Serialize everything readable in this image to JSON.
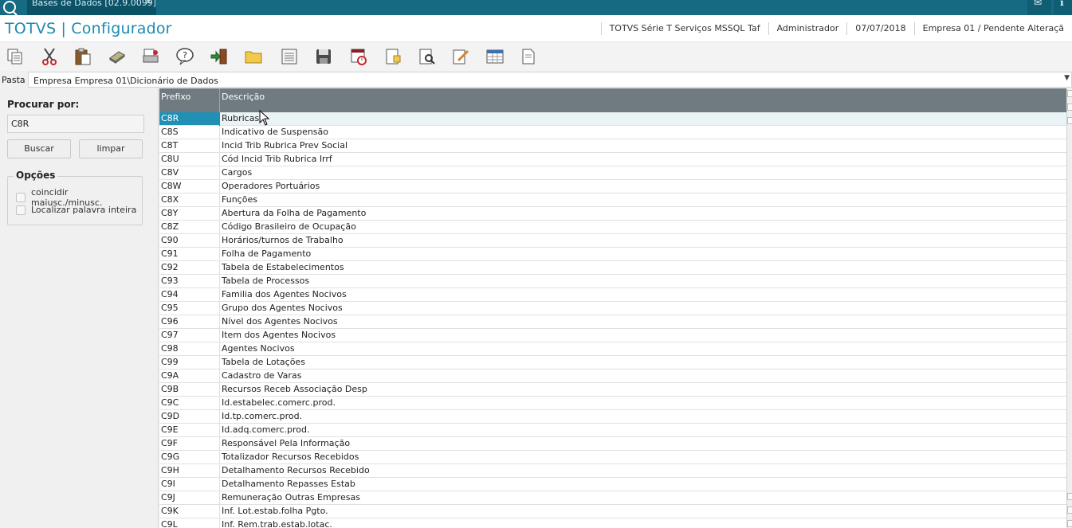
{
  "titlebar": {
    "tab_label": "Bases de Dados [02.9.0099]",
    "tab_close": "×"
  },
  "header": {
    "brand": "TOTVS | Configurador",
    "status": [
      "TOTVS Série T Serviços MSSQL Taf",
      "Administrador",
      "07/07/2018",
      "Empresa 01 / Pendente Alteraçã"
    ]
  },
  "toolbar": {
    "icons": [
      "copy-icon",
      "cut-icon",
      "paste-icon",
      "book-icon",
      "print-icon",
      "help-icon",
      "exit-icon",
      "folder-icon",
      "list-icon",
      "save-icon",
      "schedule-icon",
      "new-doc-icon",
      "search-doc-icon",
      "edit-icon",
      "calendar-icon",
      "page-icon"
    ]
  },
  "pasta": {
    "label": "Pasta",
    "value": "Empresa Empresa 01\\Dicionário de Dados"
  },
  "search": {
    "title": "Procurar por:",
    "value": "C8R",
    "buscar_label": "Buscar",
    "limpar_label": "limpar",
    "opcoes_label": "Opções",
    "option1": "coincidir maiusc./minusc.",
    "option2": "Localizar palavra inteira"
  },
  "grid": {
    "col_prefix": "Prefixo",
    "col_desc": "Descrição",
    "rows": [
      [
        "C8R",
        "Rubricas"
      ],
      [
        "C8S",
        "Indicativo de Suspensão"
      ],
      [
        "C8T",
        "Incid Trib Rubrica Prev Social"
      ],
      [
        "C8U",
        "Cód Incid Trib Rubrica Irrf"
      ],
      [
        "C8V",
        "Cargos"
      ],
      [
        "C8W",
        "Operadores Portuários"
      ],
      [
        "C8X",
        "Funções"
      ],
      [
        "C8Y",
        "Abertura da Folha de Pagamento"
      ],
      [
        "C8Z",
        "Código Brasileiro de Ocupação"
      ],
      [
        "C90",
        "Horários/turnos de Trabalho"
      ],
      [
        "C91",
        "Folha de Pagamento"
      ],
      [
        "C92",
        "Tabela de Estabelecimentos"
      ],
      [
        "C93",
        "Tabela de Processos"
      ],
      [
        "C94",
        "Familia dos Agentes Nocivos"
      ],
      [
        "C95",
        "Grupo dos Agentes Nocivos"
      ],
      [
        "C96",
        "Nível dos Agentes Nocivos"
      ],
      [
        "C97",
        "Item dos Agentes Nocivos"
      ],
      [
        "C98",
        "Agentes Nocivos"
      ],
      [
        "C99",
        "Tabela de Lotações"
      ],
      [
        "C9A",
        "Cadastro de Varas"
      ],
      [
        "C9B",
        "Recursos Receb Associação Desp"
      ],
      [
        "C9C",
        "Id.estabelec.comerc.prod."
      ],
      [
        "C9D",
        "Id.tp.comerc.prod."
      ],
      [
        "C9E",
        "Id.adq.comerc.prod."
      ],
      [
        "C9F",
        "Responsável Pela Informação"
      ],
      [
        "C9G",
        "Totalizador Recursos Recebidos"
      ],
      [
        "C9H",
        "Detalhamento Recursos Recebido"
      ],
      [
        "C9I",
        "Detalhamento Repasses Estab"
      ],
      [
        "C9J",
        "Remuneração Outras Empresas"
      ],
      [
        "C9K",
        "Inf. Lot.estab.folha Pgto."
      ],
      [
        "C9L",
        "Inf. Rem.trab.estab.lotac."
      ]
    ]
  }
}
